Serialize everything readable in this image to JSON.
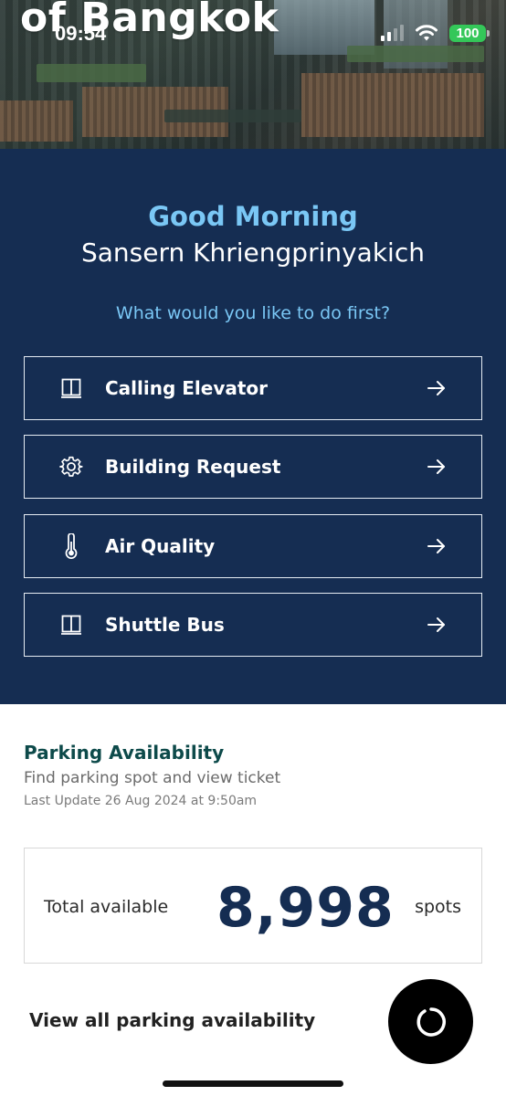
{
  "hero": {
    "title": "of Bangkok"
  },
  "status_bar": {
    "time": "09:54",
    "battery": "100"
  },
  "welcome": {
    "greeting": "Good Morning",
    "user_name": "Sansern Khriengprinyakich",
    "prompt": "What would you like to do first?"
  },
  "actions": [
    {
      "label": "Calling Elevator",
      "icon": "book-icon"
    },
    {
      "label": "Building Request",
      "icon": "gear-icon"
    },
    {
      "label": "Air Quality",
      "icon": "thermometer-icon"
    },
    {
      "label": "Shuttle Bus",
      "icon": "book-icon"
    }
  ],
  "parking": {
    "title": "Parking Availability",
    "subtitle": "Find parking spot and view ticket",
    "last_update": "Last Update 26 Aug 2024 at 9:50am",
    "total_label": "Total available",
    "count": "8,998",
    "unit": "spots",
    "view_all": "View all parking availability"
  },
  "colors": {
    "panel": "#152d52",
    "accent": "#7ac7f5",
    "parking_title": "#0d4a4a",
    "battery": "#34c759"
  }
}
